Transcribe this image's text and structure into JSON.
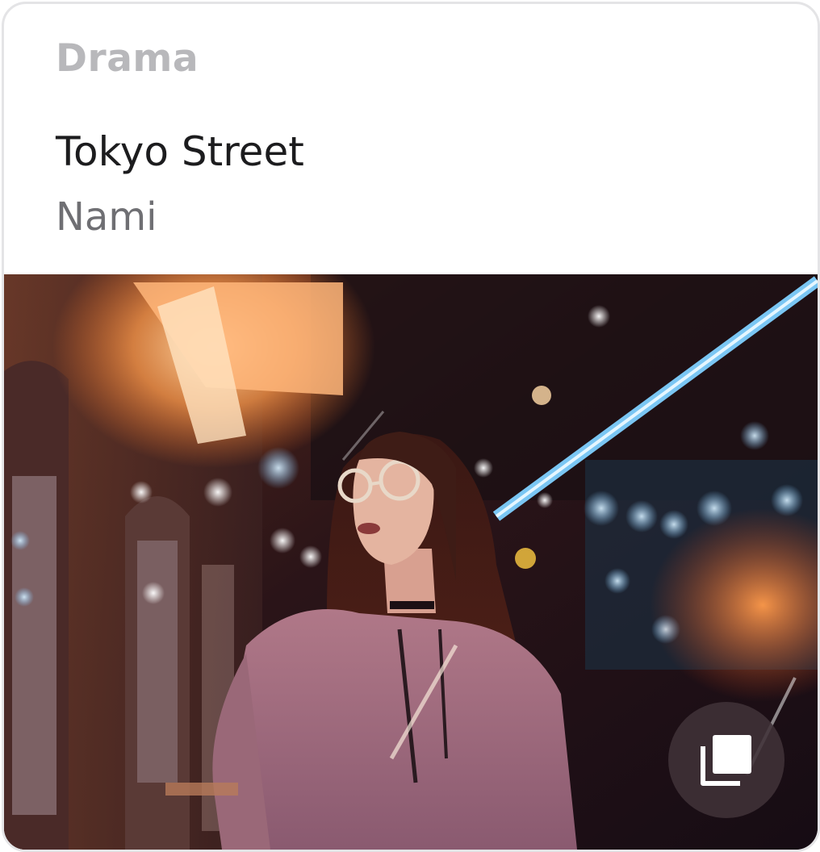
{
  "card": {
    "genre": "Drama",
    "title": "Tokyo Street",
    "author": "Nami"
  },
  "photo": {
    "subject": "woman-with-glasses-neon-street"
  },
  "actions": {
    "gallery_icon": "stacked-images-icon"
  },
  "colors": {
    "genre_text": "#b8b8bb",
    "title_text": "#1c1c1e",
    "author_text": "#6f6f73",
    "card_border": "#e4e4e6",
    "neon_blue": "#7fd0ff",
    "neon_orange": "#ff8a3c"
  }
}
